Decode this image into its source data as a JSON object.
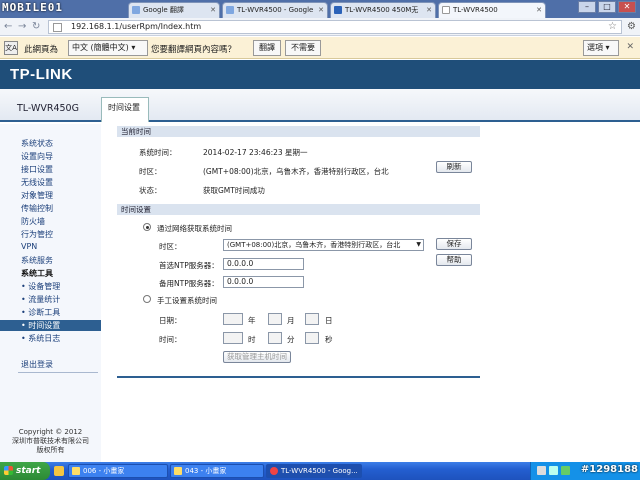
{
  "browser": {
    "logo": "MOBILE01",
    "tabs": [
      {
        "label": "Google 翻譯"
      },
      {
        "label": "TL-WVR4500 - Google"
      },
      {
        "label": "TL-WVR4500 450M无"
      },
      {
        "label": "TL-WVR4500"
      }
    ],
    "url": "192.168.1.1/userRpm/Index.htm"
  },
  "translate_bar": {
    "text1": "此網頁為",
    "lang": "中文 (簡體中文)",
    "text2": "您要翻譯網頁內容嗎？",
    "translate_btn": "翻譯",
    "no_btn": "不需要",
    "options_btn": "選項"
  },
  "router": {
    "brand": "TP-LINK",
    "model": "TL-WVR450G",
    "page_tab": "时间设置",
    "menu": [
      {
        "label": "系统状态"
      },
      {
        "label": "设置向导"
      },
      {
        "label": "接口设置"
      },
      {
        "label": "无线设置"
      },
      {
        "label": "对象管理"
      },
      {
        "label": "传输控制"
      },
      {
        "label": "防火墙"
      },
      {
        "label": "行为管控"
      },
      {
        "label": "VPN"
      },
      {
        "label": "系统服务"
      },
      {
        "label": "系统工具"
      },
      {
        "label": "• 设备管理"
      },
      {
        "label": "• 流量统计"
      },
      {
        "label": "• 诊断工具"
      },
      {
        "label": "• 时间设置"
      },
      {
        "label": "• 系统日志"
      },
      {
        "label": "退出登录"
      }
    ],
    "copyright": [
      "Copyright © 2012",
      "深圳市普联技术有限公司",
      "版权所有"
    ]
  },
  "current_time": {
    "header": "当前时间",
    "sys_time_label": "系统时间：",
    "sys_time_value": "2014-02-17  23:46:23  星期一",
    "tz_label": "时区：",
    "tz_value": "(GMT+08:00)北京，乌鲁木齐，香港特别行政区，台北",
    "status_label": "状态：",
    "status_value": "获取GMT时间成功",
    "refresh_btn": "刷新"
  },
  "time_settings": {
    "header": "时间设置",
    "auto_radio": "通过网络获取系统时间",
    "tz_label": "时区：",
    "tz_select": "(GMT+08:00)北京，乌鲁木齐，香港特别行政区，台北",
    "ntp1_label": "首选NTP服务器：",
    "ntp1_value": "0.0.0.0",
    "ntp2_label": "备用NTP服务器：",
    "ntp2_value": "0.0.0.0",
    "save_btn": "保存",
    "help_btn": "帮助",
    "manual_radio": "手工设置系统时间",
    "date_label": "日期：",
    "year": "年",
    "month": "月",
    "day": "日",
    "time_label": "时间：",
    "hour": "时",
    "minute": "分",
    "second": "秒",
    "get_host_btn": "获取管理主机时间"
  },
  "taskbar": {
    "start": "start",
    "tasks": [
      {
        "label": "006 - 小畫家"
      },
      {
        "label": "043 - 小畫家"
      },
      {
        "label": "TL-WVR4500 - Goog..."
      }
    ],
    "watermark": "#1298188"
  }
}
